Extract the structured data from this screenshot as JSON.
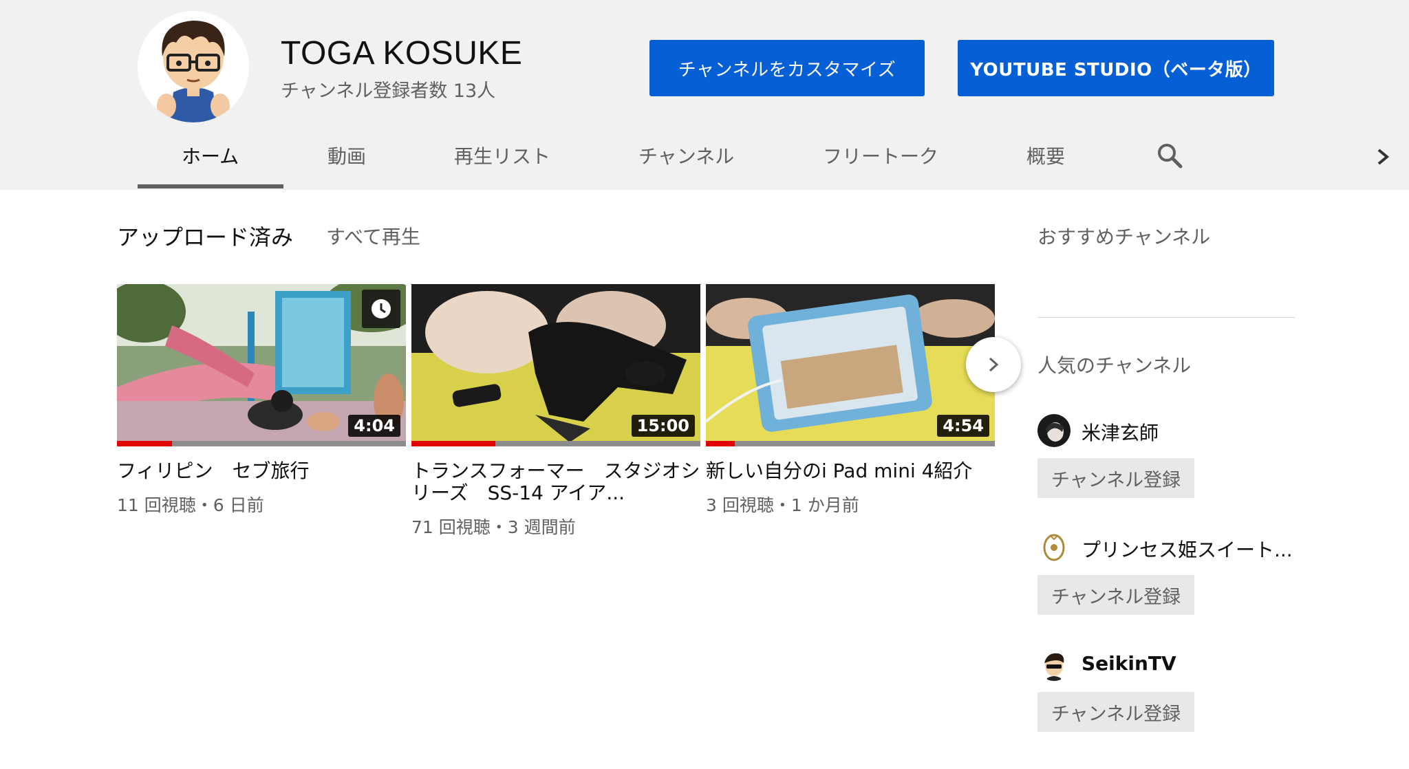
{
  "channel": {
    "name": "TOGA KOSUKE",
    "subscribers": "チャンネル登録者数 13人"
  },
  "actions": {
    "customize": "チャンネルをカスタマイズ",
    "studio": "YOUTUBE STUDIO（ベータ版）"
  },
  "tabs": [
    {
      "label": "ホーム",
      "active": true
    },
    {
      "label": "動画"
    },
    {
      "label": "再生リスト"
    },
    {
      "label": "チャンネル"
    },
    {
      "label": "フリートーク"
    },
    {
      "label": "概要"
    }
  ],
  "uploads": {
    "title": "アップロード済み",
    "play_all": "すべて再生",
    "videos": [
      {
        "title": "フィリピン　セブ旅行",
        "meta": "11 回視聴・6 日前",
        "duration": "4:04",
        "progress": 0.19
      },
      {
        "title": "トランスフォーマー　スタジオシリーズ　SS-14 アイア...",
        "meta": "71 回視聴・3 週間前",
        "duration": "15:00",
        "progress": 0.29
      },
      {
        "title": "新しい自分のi Pad mini 4紹介",
        "meta": "3 回視聴・1 か月前",
        "duration": "4:54",
        "progress": 0.1
      }
    ]
  },
  "sidebar": {
    "featured_title": "おすすめチャンネル",
    "popular_title": "人気のチャンネル",
    "channels": [
      {
        "name": "米津玄師",
        "subscribe": "チャンネル登録"
      },
      {
        "name": "プリンセス姫スイート...",
        "subscribe": "チャンネル登録"
      },
      {
        "name": "SeikinTV",
        "subscribe": "チャンネル登録"
      }
    ]
  },
  "colors": {
    "brand_blue": "#065fd4",
    "progress_red": "#e00000",
    "header_bg": "#f1f1f1"
  }
}
